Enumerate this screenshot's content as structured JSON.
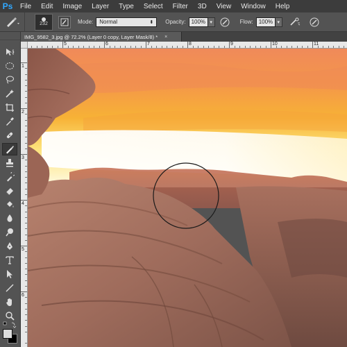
{
  "app": {
    "logo": "Ps"
  },
  "menu": [
    "File",
    "Edit",
    "Image",
    "Layer",
    "Type",
    "Select",
    "Filter",
    "3D",
    "View",
    "Window",
    "Help"
  ],
  "options": {
    "brush_size": "232",
    "mode_label": "Mode:",
    "mode_value": "Normal",
    "opacity_label": "Opacity:",
    "opacity_value": "100%",
    "flow_label": "Flow:",
    "flow_value": "100%"
  },
  "document": {
    "tab_title": "IMG_9582_3.jpg @ 72.2% (Layer 0 copy, Layer Mask/8) *",
    "close_glyph": "×"
  },
  "ruler": {
    "top_labels": [
      "5",
      "6",
      "7",
      "8",
      "9",
      "10",
      "11"
    ],
    "left_labels": [
      "1",
      "2",
      "3",
      "4",
      "5",
      "6"
    ]
  },
  "tools": {
    "active": "brush-tool",
    "icons": [
      "move-icon",
      "marquee-icon",
      "lasso-icon",
      "quick-select-icon",
      "crop-icon",
      "eyedropper-icon",
      "healing-icon",
      "brush-icon",
      "clone-stamp-icon",
      "history-brush-icon",
      "eraser-icon",
      "paint-bucket-icon",
      "blur-icon",
      "dodge-icon",
      "pen-icon",
      "type-icon",
      "path-select-icon",
      "line-icon",
      "hand-icon",
      "zoom-icon"
    ]
  },
  "colors": {
    "foreground": "#dcdcdc",
    "background": "#000000",
    "accent": "#31a8ff"
  }
}
